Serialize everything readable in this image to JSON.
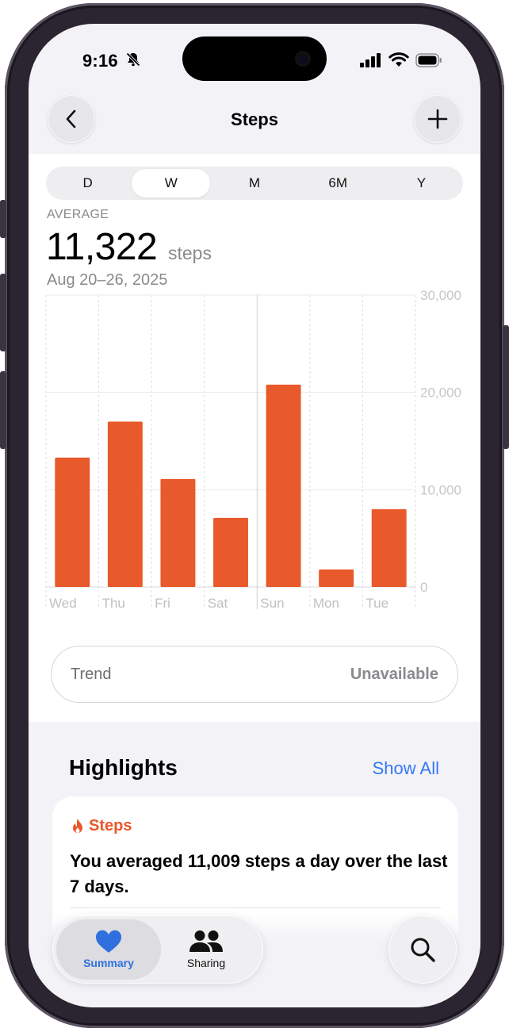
{
  "status": {
    "time": "9:16"
  },
  "header": {
    "title": "Steps"
  },
  "segments": [
    {
      "label": "D",
      "active": false
    },
    {
      "label": "W",
      "active": true
    },
    {
      "label": "M",
      "active": false
    },
    {
      "label": "6M",
      "active": false
    },
    {
      "label": "Y",
      "active": false
    }
  ],
  "summary": {
    "label": "AVERAGE",
    "value": "11,322",
    "unit": "steps",
    "range": "Aug 20–26, 2025"
  },
  "chart_data": {
    "type": "bar",
    "categories": [
      "Wed",
      "Thu",
      "Fri",
      "Sat",
      "Sun",
      "Mon",
      "Tue"
    ],
    "values": [
      13300,
      17000,
      11100,
      7100,
      20800,
      1800,
      8000
    ],
    "ylim": [
      0,
      30000
    ],
    "yticks": [
      0,
      10000,
      20000,
      30000
    ],
    "ytick_labels": [
      "0",
      "10,000",
      "20,000",
      "30,000"
    ],
    "grid": true,
    "color": "#e8592b"
  },
  "trend": {
    "label": "Trend",
    "value": "Unavailable"
  },
  "highlights": {
    "title": "Highlights",
    "show_all": "Show All",
    "card": {
      "category": "Steps",
      "text": "You averaged 11,009 steps a day over the last 7 days."
    }
  },
  "tabs": {
    "summary": "Summary",
    "sharing": "Sharing"
  },
  "colors": {
    "accent": "#e8592b",
    "link": "#3478f6",
    "tab_active": "#2f6fde"
  },
  "icons": [
    "back-chevron-icon",
    "plus-icon",
    "flame-icon",
    "heart-icon",
    "people-icon",
    "search-icon",
    "bell-slash-icon",
    "signal-icon",
    "wifi-icon",
    "battery-icon"
  ]
}
